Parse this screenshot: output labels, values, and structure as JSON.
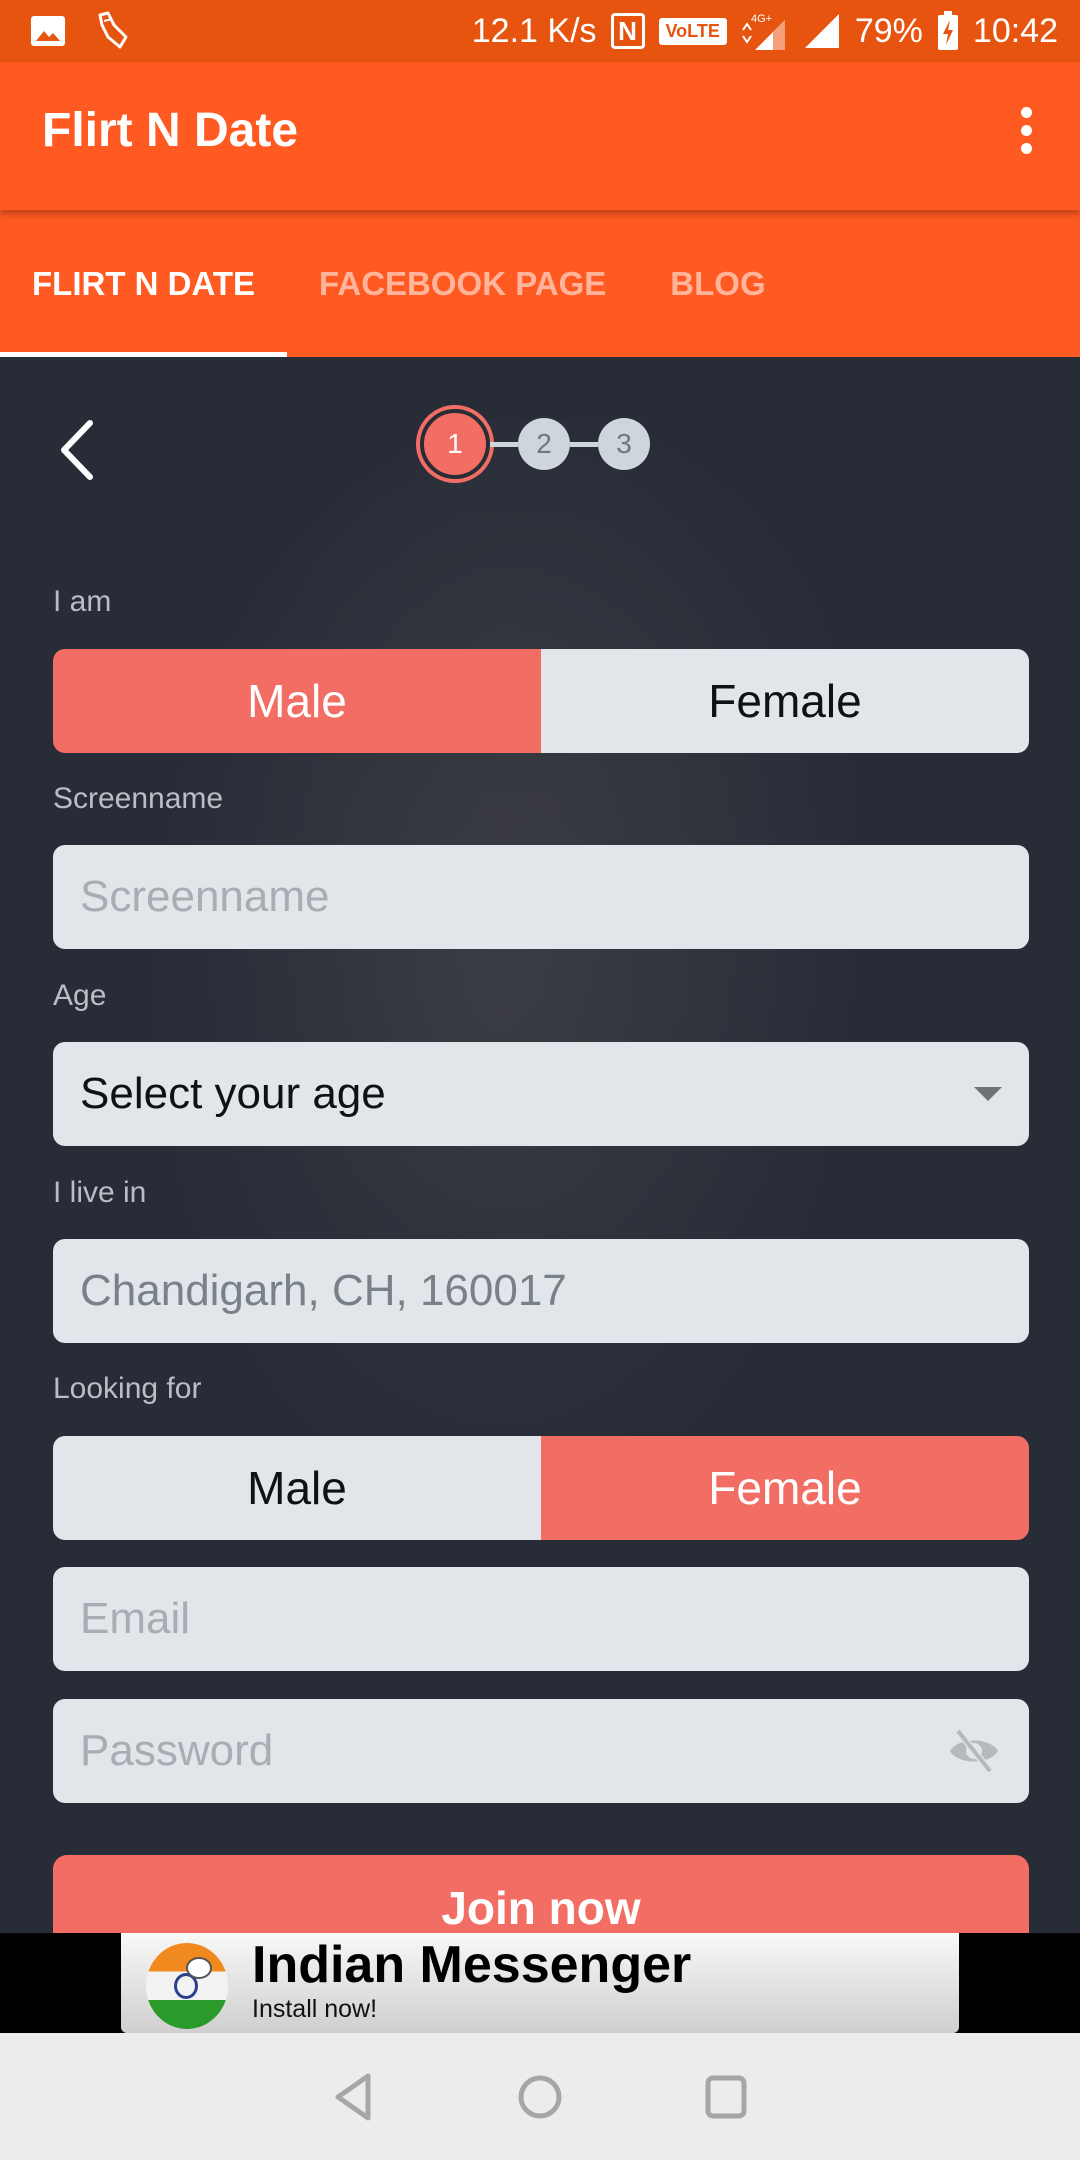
{
  "status_bar": {
    "net_speed": "12.1 K/s",
    "nfc": "N",
    "volte": "VoLTE",
    "network": "4G+",
    "battery": "79%",
    "time": "10:42",
    "icons": [
      "gallery-icon",
      "broom-icon",
      "nfc-icon",
      "volte-icon",
      "data-arrows-icon",
      "signal-icon",
      "signal-icon",
      "battery-charging-icon"
    ]
  },
  "app_bar": {
    "title": "Flirt N Date",
    "menu_icon": "overflow-menu-icon"
  },
  "tabs": [
    {
      "label": "FLIRT N DATE",
      "active": true
    },
    {
      "label": "FACEBOOK PAGE",
      "active": false
    },
    {
      "label": "BLOG",
      "active": false
    }
  ],
  "stepper": {
    "steps": [
      "1",
      "2",
      "3"
    ],
    "current": 1
  },
  "form": {
    "i_am": {
      "label": "I am",
      "options": [
        "Male",
        "Female"
      ],
      "selected": "Male"
    },
    "screenname": {
      "label": "Screenname",
      "placeholder": "Screenname",
      "value": ""
    },
    "age": {
      "label": "Age",
      "selected": "Select your age"
    },
    "location": {
      "label": "I live in",
      "value": "Chandigarh, CH, 160017"
    },
    "looking_for": {
      "label": "Looking for",
      "options": [
        "Male",
        "Female"
      ],
      "selected": "Female"
    },
    "email": {
      "placeholder": "Email",
      "value": ""
    },
    "password": {
      "placeholder": "Password",
      "value": ""
    },
    "submit_label": "Join now"
  },
  "colors": {
    "brand_orange": "#ff5a22",
    "accent_coral": "#f26d63",
    "background": "#272c37",
    "field": "#e1e6ea"
  },
  "ad": {
    "title": "Indian Messenger",
    "subtitle": "Install now!"
  }
}
